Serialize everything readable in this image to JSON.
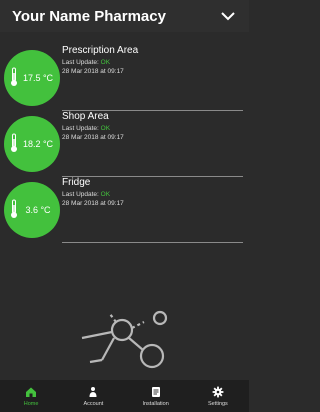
{
  "header": {
    "title": "Your Name Pharmacy"
  },
  "locations": [
    {
      "name": "Prescription Area",
      "temp": "17.5 °C",
      "update_label": "Last Update:",
      "status": "OK",
      "date": "28 Mar 2018 at 09:17"
    },
    {
      "name": "Shop Area",
      "temp": "18.2 °C",
      "update_label": "Last Update:",
      "status": "OK",
      "date": "28 Mar 2018 at 09:17"
    },
    {
      "name": "Fridge",
      "temp": "3.6 °C",
      "update_label": "Last Update:",
      "status": "OK",
      "date": "28 Mar 2018 at 09:17"
    }
  ],
  "tabs": [
    {
      "label": "Home",
      "icon": "home-icon",
      "active": true
    },
    {
      "label": "Account",
      "icon": "person-icon",
      "active": false
    },
    {
      "label": "Installation",
      "icon": "document-icon",
      "active": false
    },
    {
      "label": "Settings",
      "icon": "gear-icon",
      "active": false
    }
  ],
  "colors": {
    "accent": "#43c13d",
    "background": "#2b2b2b",
    "tabbar": "#1f1f1f"
  }
}
